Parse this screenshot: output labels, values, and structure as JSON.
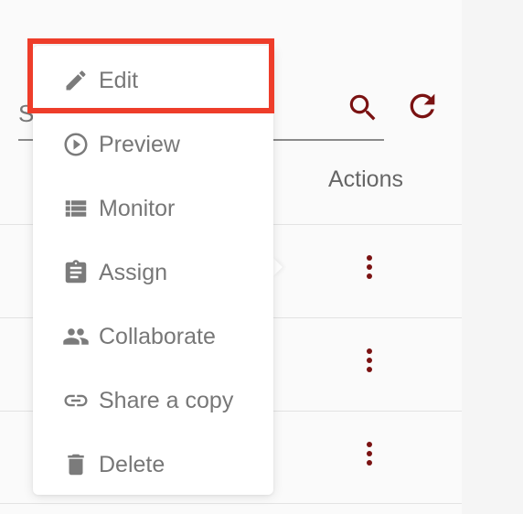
{
  "search": {
    "placeholder": "Search"
  },
  "table": {
    "actions_header": "Actions"
  },
  "menu": {
    "items": [
      {
        "label": "Edit",
        "icon": "pencil-icon"
      },
      {
        "label": "Preview",
        "icon": "play-circle-icon"
      },
      {
        "label": "Monitor",
        "icon": "list-icon"
      },
      {
        "label": "Assign",
        "icon": "clipboard-icon"
      },
      {
        "label": "Collaborate",
        "icon": "people-icon"
      },
      {
        "label": "Share a copy",
        "icon": "link-icon"
      },
      {
        "label": "Delete",
        "icon": "trash-icon"
      }
    ]
  },
  "colors": {
    "accent": "#7a1212",
    "highlight": "#ee3d2a",
    "menu_text": "#777777"
  }
}
